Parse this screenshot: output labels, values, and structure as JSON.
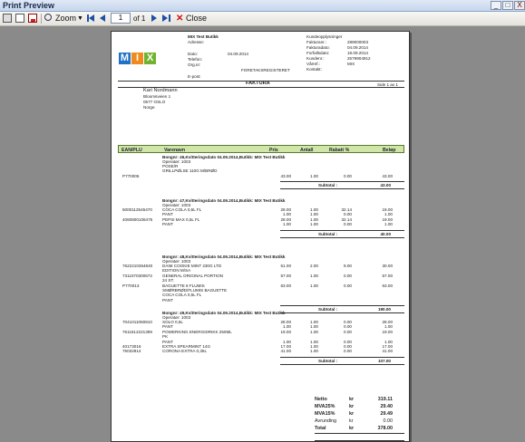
{
  "window": {
    "title": "Print Preview",
    "minimize": "_",
    "maximize": "□",
    "close": "X"
  },
  "toolbar": {
    "zoom_label": "Zoom",
    "page_value": "1",
    "page_of": "of 1",
    "close_label": "Close"
  },
  "doc": {
    "logo_letters": [
      "M",
      "I",
      "X"
    ],
    "logo_colors": [
      "#1f72c6",
      "#f08a1c",
      "#70b32e"
    ],
    "seller": {
      "name": "MIX Test Butikk",
      "adresse": "Adresse:",
      "dato_label": "Dato:",
      "dato": "04.09.2014",
      "telefon": "Telefon:",
      "org": "Org.nr:",
      "foretak": "FORETAKSREGISTERET",
      "epost": "E-post:"
    },
    "right_meta": {
      "heading": "Kundeopplysninger",
      "rows": [
        {
          "label": "Fakturanr.:",
          "value": "289000003"
        },
        {
          "label": "Fakturadato:",
          "value": "04.09.2014"
        },
        {
          "label": "Forfallsdato:",
          "value": "18.09.2014"
        },
        {
          "label": "Kundenr.:",
          "value": "2579904912"
        },
        {
          "label": "Vårref.:",
          "value": "MIX"
        },
        {
          "label": "Kontakt:",
          "value": ""
        }
      ]
    },
    "faktura_title": "FAKTURA",
    "side": "Side 1 av 1",
    "customer": [
      "Kari Nordmann",
      "Bloomsveien 1",
      "0577 OSLO",
      "Norge"
    ],
    "columns": [
      "EAN/PLU",
      "Varenavn",
      "Pris",
      "Antall",
      "Rabatt %",
      "Beløp"
    ],
    "sections": [
      {
        "head": "Bongnr: 46,Kvitteringsdato 04.09.2014,Butikk: MIX Test Butikk",
        "operator": "Operatør: 1003",
        "rows": [
          {
            "ean": "",
            "name": "POSE/R",
            "price": "",
            "qty": "",
            "disc": "",
            "amt": ""
          },
          {
            "ean": "",
            "name": "GRILLPØLSE 110G M/BRØD",
            "price": "",
            "qty": "",
            "disc": "",
            "amt": ""
          },
          {
            "ean": "P770005",
            "name": "",
            "price": "43.00",
            "qty": "1.00",
            "disc": "0.00",
            "amt": "43.00"
          }
        ],
        "subtotal_label": "Subtotal :",
        "subtotal": "43.00"
      },
      {
        "head": "Bongnr: 47,Kvitteringsdato 04.09.2014,Butikk: MIX Test Butikk",
        "operator": "Operatør: 1003",
        "rows": [
          {
            "ean": "5000112545470",
            "name": "COCA COLA 0,5L FL",
            "price": "28.00",
            "qty": "1.00",
            "disc": "32.14",
            "amt": "19.00"
          },
          {
            "ean": "",
            "name": "PANT",
            "price": "1.00",
            "qty": "1.00",
            "disc": "0.00",
            "amt": "1.00"
          },
          {
            "ean": "4060800106475",
            "name": "PEPSI MAX 0,5L FL",
            "price": "28.00",
            "qty": "1.00",
            "disc": "32.14",
            "amt": "19.00"
          },
          {
            "ean": "",
            "name": "PANT",
            "price": "1.00",
            "qty": "1.00",
            "disc": "0.00",
            "amt": "1.00"
          }
        ],
        "subtotal_label": "Subtotal :",
        "subtotal": "40.00"
      },
      {
        "head": "Bongnr: 48,Kvitteringsdato 04.09.2014,Butikk: MIX Test Butikk",
        "operator": "Operatør: 1003",
        "rows": [
          {
            "ean": "7622210354840",
            "name": "DAIM COOKIE MINT 230G LTD",
            "price": "51.00",
            "qty": "2.00",
            "disc": "9.00",
            "amt": "30.00"
          },
          {
            "ean": "",
            "name": "EDITION M/SA",
            "price": "",
            "qty": "",
            "disc": "",
            "amt": ""
          },
          {
            "ean": "7311070300672",
            "name": "GENERAL ORIGINAL PORTION",
            "price": "57.00",
            "qty": "1.00",
            "disc": "0.00",
            "amt": "57.00"
          },
          {
            "ean": "",
            "name": "24 ST.",
            "price": "",
            "qty": "",
            "disc": "",
            "amt": ""
          },
          {
            "ean": "P770013",
            "name": "BAGUETTE 8 FLUMIS",
            "price": "63.00",
            "qty": "1.00",
            "disc": "0.00",
            "amt": "63.00"
          },
          {
            "ean": "",
            "name": "SMØRBRØD/FLUMIS BAGUETTE",
            "price": "",
            "qty": "",
            "disc": "",
            "amt": ""
          },
          {
            "ean": "",
            "name": "COCA COLA 0,5L FL",
            "price": "",
            "qty": "",
            "disc": "",
            "amt": ""
          },
          {
            "ean": "",
            "name": "PANT",
            "price": "",
            "qty": "",
            "disc": "",
            "amt": ""
          }
        ],
        "subtotal_label": "Subtotal :",
        "subtotal": "190.00"
      },
      {
        "head": "Bongnr: 49,Kvitteringsdato 04.09.2014,Butikk: MIX Test Butikk",
        "operator": "Operatør: 1003",
        "rows": [
          {
            "ean": "7041011050810",
            "name": "SOLO 0,5L",
            "price": "28.00",
            "qty": "1.00",
            "disc": "0.00",
            "amt": "28.00"
          },
          {
            "ean": "",
            "name": "PANT",
            "price": "1.00",
            "qty": "1.00",
            "disc": "0.00",
            "amt": "1.00"
          },
          {
            "ean": "7611612221399",
            "name": "POWERKING ENERGIDRIKK 250ML",
            "price": "19.00",
            "qty": "1.00",
            "disc": "0.00",
            "amt": "19.00"
          },
          {
            "ean": "",
            "name": "PK",
            "price": "",
            "qty": "",
            "disc": "",
            "amt": ""
          },
          {
            "ean": "",
            "name": "PANT",
            "price": "1.00",
            "qty": "1.00",
            "disc": "0.00",
            "amt": "1.00"
          },
          {
            "ean": "40173016",
            "name": "EXTRA SPEARMINT 14G",
            "price": "17.00",
            "qty": "1.00",
            "disc": "0.00",
            "amt": "17.00"
          },
          {
            "ean": "75032814",
            "name": "CORONA EXTRA 0,35L",
            "price": "41.00",
            "qty": "1.00",
            "disc": "0.00",
            "amt": "41.00"
          }
        ],
        "subtotal_label": "Subtotal :",
        "subtotal": "107.00"
      }
    ],
    "totals": [
      {
        "label": "Netto",
        "unit": "kr",
        "value": "319.11",
        "bold": true
      },
      {
        "label": "MVA25%",
        "unit": "kr",
        "value": "29.40",
        "bold": true
      },
      {
        "label": "MVA15%",
        "unit": "kr",
        "value": "29.49",
        "bold": true
      },
      {
        "label": "Avrunding",
        "unit": "kr",
        "value": "0.00",
        "bold": false
      },
      {
        "label": "Total",
        "unit": "kr",
        "value": "378.00",
        "bold": true
      }
    ]
  }
}
